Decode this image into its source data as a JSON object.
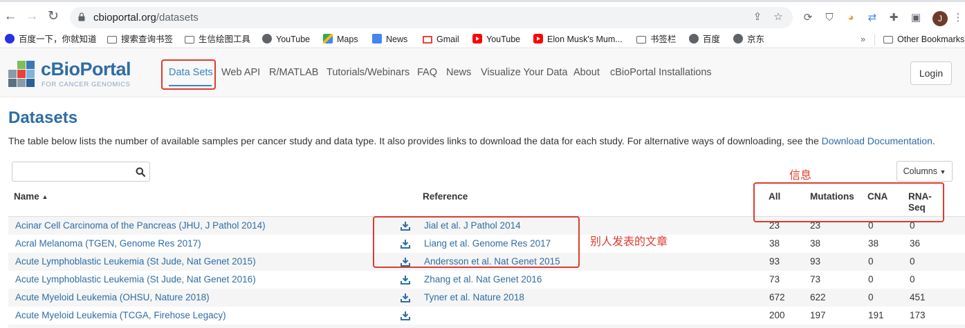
{
  "browser": {
    "url_host": "cbioportal.org",
    "url_path": "/datasets",
    "avatar_letter": "J",
    "bookmarks": [
      {
        "label": "百度一下，你就知道",
        "icon": "baidu-paw-icon"
      },
      {
        "label": "搜索查询书签",
        "icon": "folder-icon"
      },
      {
        "label": "生信绘图工具",
        "icon": "folder-icon"
      },
      {
        "label": "YouTube",
        "icon": "globe-icon"
      },
      {
        "label": "Maps",
        "icon": "maps-icon"
      },
      {
        "label": "News",
        "icon": "news-icon"
      },
      {
        "label": "Gmail",
        "icon": "gmail-icon"
      },
      {
        "label": "YouTube",
        "icon": "youtube-icon"
      },
      {
        "label": "Elon Musk's Mum...",
        "icon": "youtube-icon"
      },
      {
        "label": "书签栏",
        "icon": "folder-icon"
      },
      {
        "label": "百度",
        "icon": "globe-icon"
      },
      {
        "label": "京东",
        "icon": "globe-icon"
      }
    ],
    "overflow": "»",
    "other_bookmarks": "Other Bookmarks"
  },
  "site": {
    "logo_text": "cBioPortal",
    "logo_sub": "FOR CANCER GENOMICS",
    "nav": [
      "Data Sets",
      "Web API",
      "R/MATLAB",
      "Tutorials/Webinars",
      "FAQ",
      "News",
      "Visualize Your Data",
      "About",
      "cBioPortal Installations"
    ],
    "login": "Login"
  },
  "page": {
    "title": "Datasets",
    "intro": "The table below lists the number of available samples per cancer study and data type. It also provides links to download the data for each study. For alternative ways of downloading, see the ",
    "intro_link": "Download Documentation",
    "intro_end": ".",
    "search_value": "",
    "columns_button": "Columns"
  },
  "table": {
    "headers": {
      "name": "Name",
      "reference": "Reference",
      "all": "All",
      "mutations": "Mutations",
      "cna": "CNA",
      "rna": "RNA-Seq"
    },
    "sort_indicator": "▲",
    "rows": [
      {
        "name": "Acinar Cell Carcinoma of the Pancreas (JHU, J Pathol 2014)",
        "reference": "Jial et al. J Pathol 2014",
        "all": "23",
        "mutations": "23",
        "cna": "0",
        "rna": "0"
      },
      {
        "name": "Acral Melanoma (TGEN, Genome Res 2017)",
        "reference": "Liang et al. Genome Res 2017",
        "all": "38",
        "mutations": "38",
        "cna": "38",
        "rna": "36"
      },
      {
        "name": "Acute Lymphoblastic Leukemia (St Jude, Nat Genet 2015)",
        "reference": "Andersson et al. Nat Genet 2015",
        "all": "93",
        "mutations": "93",
        "cna": "0",
        "rna": "0"
      },
      {
        "name": "Acute Lymphoblastic Leukemia (St Jude, Nat Genet 2016)",
        "reference": "Zhang et al. Nat Genet 2016",
        "all": "73",
        "mutations": "73",
        "cna": "0",
        "rna": "0"
      },
      {
        "name": "Acute Myeloid Leukemia (OHSU, Nature 2018)",
        "reference": "Tyner et al. Nature 2018",
        "all": "672",
        "mutations": "622",
        "cna": "0",
        "rna": "451"
      },
      {
        "name": "Acute Myeloid Leukemia (TCGA, Firehose Legacy)",
        "reference": "",
        "all": "200",
        "mutations": "197",
        "cna": "191",
        "rna": "173"
      }
    ]
  },
  "annotations": {
    "info_label": "信息",
    "articles_label": "别人发表的文章",
    "color": "#e03a2e"
  }
}
